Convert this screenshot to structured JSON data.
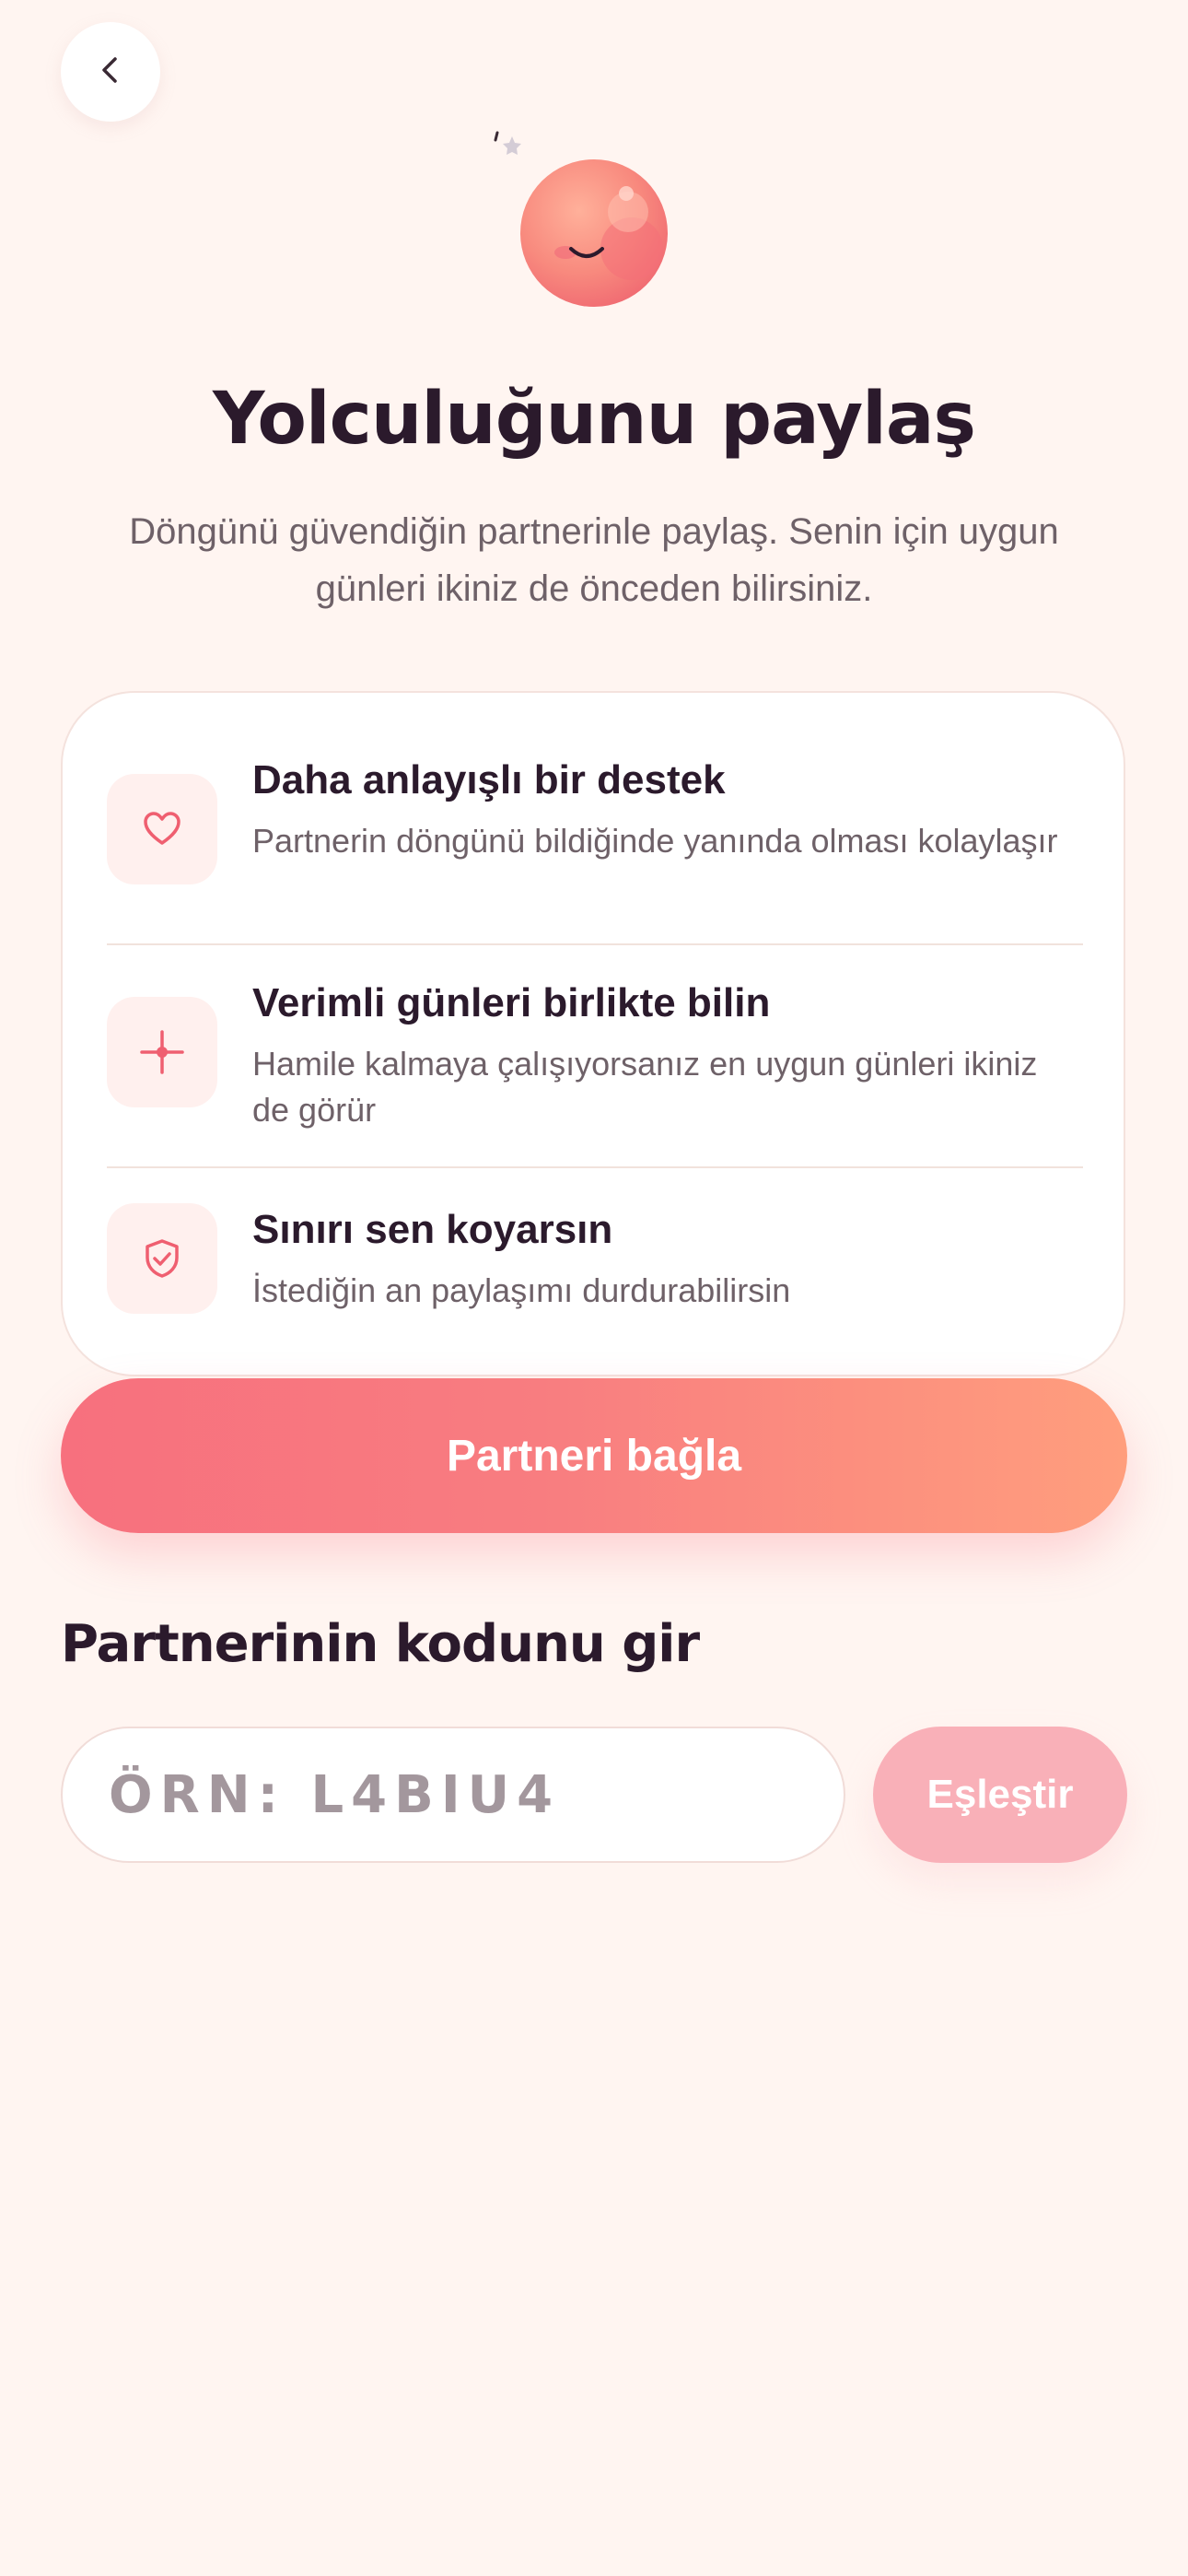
{
  "header": {
    "back_icon": "chevron-left-icon"
  },
  "hero": {
    "mascot_icon": "smiling-moon-mascot",
    "star_icon": "star-icon",
    "title": "Yolculuğunu paylaş",
    "subtitle": "Döngünü güvendiğin partnerinle paylaş. Senin için uygun günleri ikiniz de önceden bilirsiniz."
  },
  "features": [
    {
      "icon": "heart-icon",
      "title": "Daha anlayışlı bir destek",
      "description": "Partnerin döngünü bildiğinde yanında olması kolaylaşır"
    },
    {
      "icon": "sparkle-icon",
      "title": "Verimli günleri birlikte bilin",
      "description": "Hamile kalmaya çalışıyorsanız en uygun günleri ikiniz de görür"
    },
    {
      "icon": "shield-check-icon",
      "title": "Sınırı sen koyarsın",
      "description": "İstediğin an paylaşımı durdurabilirsin"
    }
  ],
  "primary_button": {
    "label": "Partneri bağla"
  },
  "code_section": {
    "title": "Partnerinin kodunu gir",
    "input_placeholder": "ÖRN: L4BIU4",
    "input_value": "",
    "match_button_label": "Eşleştir"
  },
  "colors": {
    "background": "#fff5f1",
    "accent_start": "#f7707e",
    "accent_end": "#ff9e7d",
    "icon_red": "#ef5f70",
    "match_button": "#f9b0b8"
  }
}
